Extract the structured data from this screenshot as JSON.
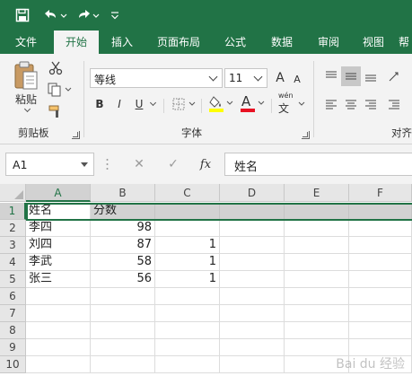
{
  "quick_access": {
    "save_icon": "save-icon",
    "undo_icon": "undo-icon",
    "redo_icon": "redo-icon",
    "customize_icon": "customize-dropdown-icon"
  },
  "tabs": [
    {
      "label": "文件"
    },
    {
      "label": "开始"
    },
    {
      "label": "插入"
    },
    {
      "label": "页面布局"
    },
    {
      "label": "公式"
    },
    {
      "label": "数据"
    },
    {
      "label": "审阅"
    },
    {
      "label": "视图"
    },
    {
      "label": "帮"
    }
  ],
  "active_tab": "开始",
  "ribbon": {
    "clipboard": {
      "paste_label": "粘贴",
      "group_label": "剪贴板"
    },
    "font": {
      "font_name": "等线",
      "font_size": "11",
      "bold": "B",
      "italic": "I",
      "underline": "U",
      "font_color_letter": "A",
      "font_color": "#e81123",
      "fill_color": "#ffff00",
      "phonetic_label": "wén",
      "phonetic_char": "文",
      "grow_font": "A",
      "shrink_font": "A",
      "group_label": "字体"
    },
    "alignment": {
      "group_label": "对齐"
    }
  },
  "formula_bar": {
    "name_box": "A1",
    "cancel_symbol": "✕",
    "enter_symbol": "✓",
    "fx_label": "fx",
    "content": "姓名"
  },
  "sheet": {
    "columns": [
      "A",
      "B",
      "C",
      "D",
      "E",
      "F"
    ],
    "rows": [
      [
        "姓名",
        "分数",
        "",
        "",
        "",
        ""
      ],
      [
        "李四",
        "98",
        "",
        "",
        "",
        ""
      ],
      [
        "刘四",
        "87",
        "1",
        "",
        "",
        ""
      ],
      [
        "李武",
        "58",
        "1",
        "",
        "",
        ""
      ],
      [
        "张三",
        "56",
        "1",
        "",
        "",
        ""
      ],
      [
        "",
        "",
        "",
        "",
        "",
        ""
      ],
      [
        "",
        "",
        "",
        "",
        "",
        ""
      ],
      [
        "",
        "",
        "",
        "",
        "",
        ""
      ],
      [
        "",
        "",
        "",
        "",
        "",
        ""
      ],
      [
        "",
        "",
        "",
        "",
        "",
        ""
      ]
    ],
    "row_numbers": [
      "1",
      "2",
      "3",
      "4",
      "5",
      "6",
      "7",
      "8",
      "9",
      "10"
    ],
    "selected_row": 1
  },
  "watermark": "Bai du 经验",
  "colors": {
    "brand": "#217346",
    "ribbon_bg": "#f3f3f3",
    "header_bg": "#e6e6e6",
    "selected_header_bg": "#d2d2d2"
  }
}
